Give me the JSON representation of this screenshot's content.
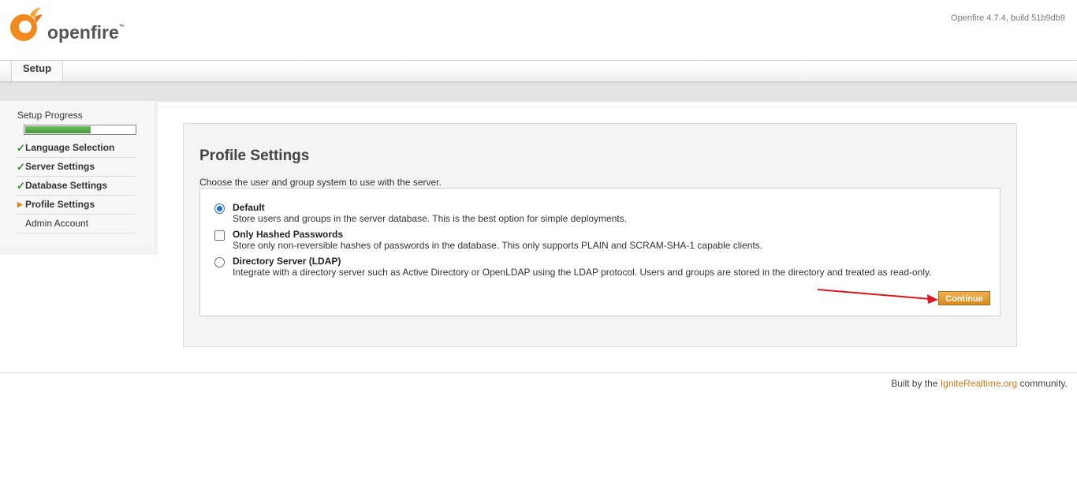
{
  "header": {
    "logo_text": "openfire",
    "logo_tm": "™",
    "version": "Openfire 4.7.4, build 51b9db9"
  },
  "tabs": [
    {
      "label": "Setup"
    }
  ],
  "sidebar": {
    "progress_title": "Setup Progress",
    "progress_fraction": 0.6,
    "steps": [
      {
        "label": "Language Selection",
        "state": "done"
      },
      {
        "label": "Server Settings",
        "state": "done"
      },
      {
        "label": "Database Settings",
        "state": "done"
      },
      {
        "label": "Profile Settings",
        "state": "active"
      },
      {
        "label": "Admin Account",
        "state": "pending"
      }
    ]
  },
  "main": {
    "title": "Profile Settings",
    "description": "Choose the user and group system to use with the server.",
    "options": [
      {
        "label": "Default",
        "description": "Store users and groups in the server database. This is the best option for simple deployments.",
        "control": "radio",
        "checked": true
      },
      {
        "label": "Only Hashed Passwords",
        "description": "Store only non-reversible hashes of passwords in the database. This only supports PLAIN and SCRAM-SHA-1 capable clients.",
        "control": "checkbox",
        "checked": false
      },
      {
        "label": "Directory Server (LDAP)",
        "description": "Integrate with a directory server such as Active Directory or OpenLDAP using the LDAP protocol. Users and groups are stored in the directory and treated as read-only.",
        "control": "radio",
        "checked": false
      }
    ],
    "continue_label": "Continue"
  },
  "footer": {
    "prefix": "Built by the ",
    "link": "IgniteRealtime.org",
    "suffix": " community."
  },
  "colors": {
    "accent": "#d48b1e",
    "progress": "#4a9a3e",
    "annotation_arrow": "#e0141e"
  }
}
